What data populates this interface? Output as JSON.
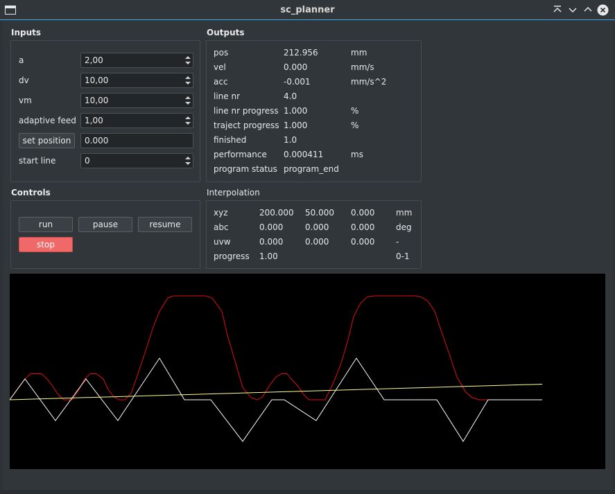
{
  "window": {
    "title": "sc_planner",
    "controls": [
      "collapse-top-icon",
      "minimize-icon",
      "maximize-icon",
      "close-icon"
    ]
  },
  "inputs": {
    "title": "Inputs",
    "rows": [
      {
        "label": "a",
        "value": "2,00"
      },
      {
        "label": "dv",
        "value": "10,00"
      },
      {
        "label": "vm",
        "value": "10,00"
      },
      {
        "label": "adaptive feed",
        "value": "1,00"
      }
    ],
    "set_position_label": "set position",
    "set_position_value": "0.000",
    "start_line_label": "start line",
    "start_line_value": "0"
  },
  "outputs": {
    "title": "Outputs",
    "rows": [
      {
        "label": "pos",
        "value": "212.956",
        "unit": "mm"
      },
      {
        "label": "vel",
        "value": "0.000",
        "unit": "mm/s"
      },
      {
        "label": "acc",
        "value": "-0.001",
        "unit": "mm/s^2"
      },
      {
        "label": "line nr",
        "value": "4.0",
        "unit": ""
      },
      {
        "label": "line nr progress",
        "value": "1.000",
        "unit": "%"
      },
      {
        "label": "traject progress",
        "value": "1.000",
        "unit": "%"
      },
      {
        "label": "finished",
        "value": "1.0",
        "unit": ""
      },
      {
        "label": "performance",
        "value": "0.000411",
        "unit": "ms"
      },
      {
        "label": "program status",
        "value": "program_end",
        "unit": ""
      }
    ]
  },
  "controls": {
    "title": "Controls",
    "run": "run",
    "pause": "pause",
    "resume": "resume",
    "stop": "stop"
  },
  "interpolation": {
    "title": "Interpolation",
    "rows": [
      {
        "label": "xyz",
        "v1": "200.000",
        "v2": "50.000",
        "v3": "0.000",
        "unit": "mm"
      },
      {
        "label": "abc",
        "v1": "0.000",
        "v2": "0.000",
        "v3": "0.000",
        "unit": "deg"
      },
      {
        "label": "uvw",
        "v1": "0.000",
        "v2": "0.000",
        "v3": "0.000",
        "unit": "-"
      },
      {
        "label": "progress",
        "v1": "1.00",
        "v2": "",
        "v3": "",
        "unit": "0-1"
      }
    ]
  },
  "chart_data": {
    "type": "line",
    "title": "",
    "xlabel": "",
    "ylabel": "",
    "background": "#000000",
    "grid": false,
    "series": [
      {
        "color": "#e01010",
        "x": [
          0,
          14,
          22,
          30,
          46,
          54,
          62,
          70,
          78,
          90,
          100,
          108,
          116,
          125,
          135,
          142,
          150,
          158,
          166,
          175,
          185,
          195,
          207,
          216,
          228,
          236,
          246,
          256,
          264,
          274,
          282,
          292,
          306,
          314,
          326,
          336,
          348,
          357,
          365,
          374,
          384,
          392,
          400,
          406,
          416,
          424,
          432,
          444,
          455,
          466,
          478,
          488,
          496,
          506,
          516,
          526,
          536,
          547,
          555,
          565,
          575,
          585,
          593,
          603,
          613,
          623,
          635,
          645,
          657,
          667,
          677,
          685,
          695,
          705,
          720,
          740,
          768
        ],
        "y": [
          0.0,
          0.13,
          0.2,
          0.25,
          0.25,
          0.2,
          0.13,
          0.05,
          0.0,
          0.0,
          0.1,
          0.2,
          0.25,
          0.25,
          0.2,
          0.1,
          0.03,
          0.0,
          0.0,
          0.06,
          0.25,
          0.45,
          0.7,
          0.85,
          0.98,
          1.0,
          1.0,
          1.0,
          1.0,
          1.0,
          1.0,
          0.98,
          0.85,
          0.62,
          0.35,
          0.12,
          0.02,
          0.0,
          0.03,
          0.13,
          0.22,
          0.25,
          0.25,
          0.2,
          0.13,
          0.05,
          0.0,
          0.0,
          0.0,
          0.15,
          0.35,
          0.58,
          0.8,
          0.93,
          0.99,
          1.0,
          1.0,
          1.0,
          1.0,
          1.0,
          1.0,
          1.0,
          0.99,
          0.95,
          0.85,
          0.65,
          0.42,
          0.22,
          0.08,
          0.02,
          0.0,
          0.0,
          0.0,
          0.0,
          0.0,
          0.0,
          0.0
        ]
      },
      {
        "color": "#ffffff",
        "x": [
          0,
          22,
          66,
          110,
          156,
          216,
          252,
          290,
          336,
          378,
          396,
          442,
          500,
          540,
          566,
          616,
          654,
          690,
          768
        ],
        "y": [
          0.0,
          0.2,
          -0.2,
          0.2,
          -0.2,
          0.4,
          0.0,
          0.0,
          -0.4,
          0.0,
          0.0,
          -0.2,
          0.4,
          0.0,
          0.0,
          0.0,
          -0.4,
          0.0,
          0.0
        ]
      },
      {
        "color": "#ffff99",
        "x": [
          0,
          768
        ],
        "y": [
          0.0,
          0.15
        ]
      }
    ]
  }
}
